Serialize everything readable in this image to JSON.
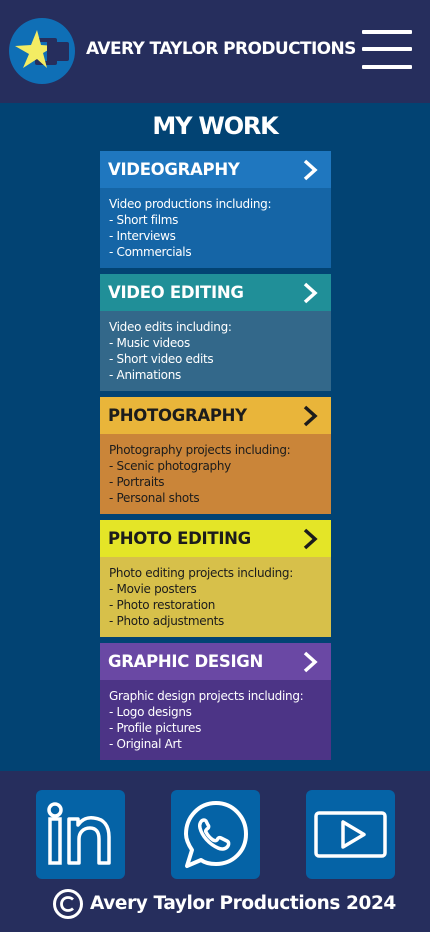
{
  "header": {
    "brand": "AVERY TAYLOR PRODUCTIONS",
    "logo_icon": "star-camera-logo",
    "menu_icon": "hamburger-menu-icon"
  },
  "main": {
    "title": "MY WORK",
    "cards": [
      {
        "title": "VIDEOGRAPHY",
        "header_color": "#1f77bf",
        "body_color": "#1565a6",
        "text_color": "#ffffff",
        "arrow_icon": "chevron-right-icon",
        "lines": [
          "Video productions including:",
          "- Short films",
          "- Interviews",
          "- Commercials"
        ]
      },
      {
        "title": "VIDEO EDITING",
        "header_color": "#208f98",
        "body_color": "#33688a",
        "text_color": "#ffffff",
        "arrow_icon": "chevron-right-icon",
        "lines": [
          "Video edits including:",
          "- Music videos",
          "- Short video edits",
          "- Animations"
        ]
      },
      {
        "title": "PHOTOGRAPHY",
        "header_color": "#e9b53a",
        "body_color": "#ca8539",
        "text_color": "#1c1c1c",
        "arrow_icon": "chevron-right-icon",
        "lines": [
          "Photography projects including:",
          "- Scenic photography",
          "- Portraits",
          "- Personal shots"
        ]
      },
      {
        "title": "PHOTO EDITING",
        "header_color": "#e4e527",
        "body_color": "#d7c04a",
        "text_color": "#1c1c1c",
        "arrow_icon": "chevron-right-icon",
        "lines": [
          "Photo editing projects including:",
          "- Movie posters",
          "- Photo restoration",
          "- Photo adjustments"
        ]
      },
      {
        "title": "GRAPHIC DESIGN",
        "header_color": "#6a48a4",
        "body_color": "#4c3486",
        "text_color": "#ffffff",
        "arrow_icon": "chevron-right-icon",
        "lines": [
          "Graphic design projects including:",
          "- Logo designs",
          "- Profile pictures",
          "- Original Art"
        ]
      }
    ]
  },
  "footer": {
    "social": [
      {
        "name": "linkedin-icon"
      },
      {
        "name": "whatsapp-icon"
      },
      {
        "name": "youtube-play-icon"
      }
    ],
    "copyright_icon": "copyright-icon",
    "copyright": "Avery Taylor Productions 2024"
  }
}
